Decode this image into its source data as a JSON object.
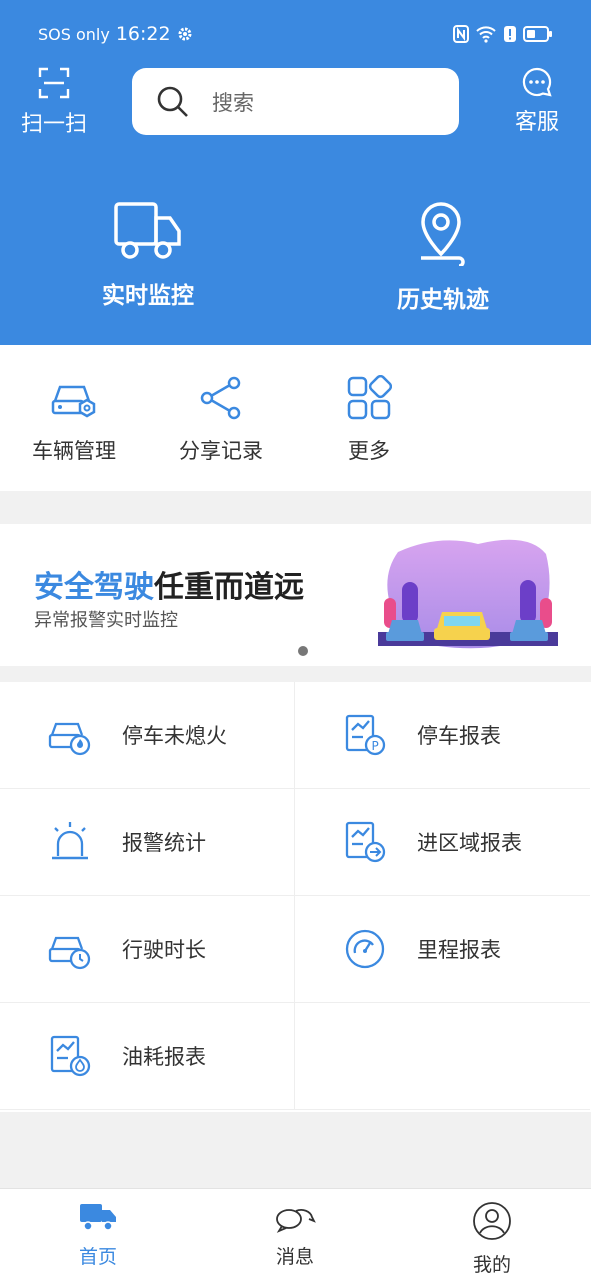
{
  "status_bar": {
    "network": "SOS only",
    "time": "16:22"
  },
  "header": {
    "scan_label": "扫一扫",
    "search_placeholder": "搜索",
    "service_label": "客服",
    "realtime_label": "实时监控",
    "history_label": "历史轨迹"
  },
  "quick_actions": [
    {
      "label": "车辆管理",
      "icon": "car-settings-icon"
    },
    {
      "label": "分享记录",
      "icon": "share-icon"
    },
    {
      "label": "更多",
      "icon": "apps-icon"
    }
  ],
  "banner": {
    "title_highlight": "安全驾驶",
    "title_rest": "任重而道远",
    "subtitle": "异常报警实时监控"
  },
  "reports": [
    {
      "label": "停车未熄火",
      "icon": "car-flame-icon"
    },
    {
      "label": "停车报表",
      "icon": "parking-report-icon"
    },
    {
      "label": "报警统计",
      "icon": "alarm-light-icon"
    },
    {
      "label": "进区域报表",
      "icon": "area-entry-report-icon"
    },
    {
      "label": "行驶时长",
      "icon": "car-clock-icon"
    },
    {
      "label": "里程报表",
      "icon": "speedometer-icon"
    },
    {
      "label": "油耗报表",
      "icon": "fuel-report-icon"
    }
  ],
  "tabbar": {
    "home": "首页",
    "messages": "消息",
    "mine": "我的"
  },
  "colors": {
    "primary": "#3b89e0",
    "background": "#f1f1f1"
  }
}
